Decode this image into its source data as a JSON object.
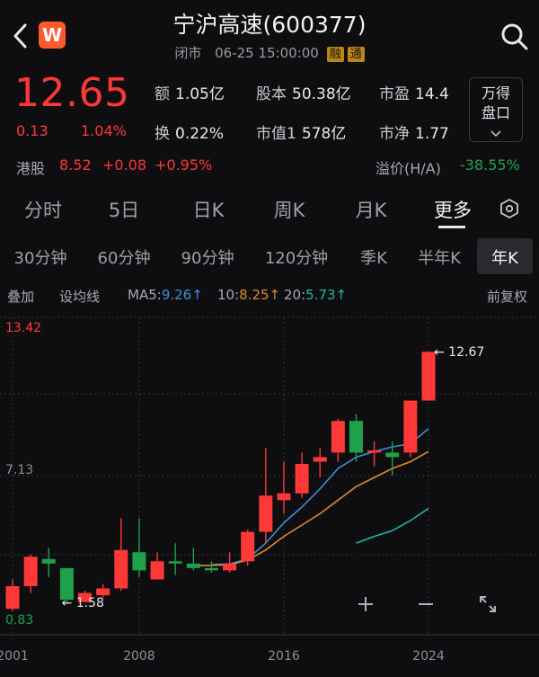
{
  "header": {
    "title": "宁沪高速(600377)",
    "market": "闭市",
    "datetime": "06-25 15:00:00",
    "tags": [
      "融",
      "通"
    ]
  },
  "quote": {
    "price": "12.65",
    "change": "0.13",
    "change_pct": "1.04%",
    "stats": {
      "amount_label": "额",
      "amount": "1.05亿",
      "share_label": "股本",
      "share": "50.38亿",
      "pe_label": "市盈",
      "pe": "14.4",
      "turnover_label": "换",
      "turnover": "0.22%",
      "mcap_label": "市值1",
      "mcap": "578亿",
      "pb_label": "市净",
      "pb": "1.77"
    },
    "wande": [
      "万得",
      "盘口"
    ]
  },
  "hk": {
    "label": "港股",
    "price": "8.52",
    "change": "+0.08",
    "change_pct": "+0.95%",
    "premium_label": "溢价(H/A)",
    "premium": "-38.55%"
  },
  "period_tabs": [
    "分时",
    "5日",
    "日K",
    "周K",
    "月K",
    "更多"
  ],
  "interval_tabs": [
    "30分钟",
    "60分钟",
    "90分钟",
    "120分钟",
    "季K",
    "半年K",
    "年K"
  ],
  "ma": {
    "overlay": "叠加",
    "setting": "设均线",
    "ma5_label": "MA5:",
    "ma5": "9.26↑",
    "ma10_label": "10:",
    "ma10": "8.25↑",
    "ma20_label": "20:",
    "ma20": "5.73↑",
    "adjust": "前复权"
  },
  "colors": {
    "up": "#ff3838",
    "down": "#1fa14b",
    "ma5": "#3b8fd8",
    "ma10": "#e08a2a",
    "ma20": "#1fb7a8"
  },
  "chart_data": {
    "type": "candlestick",
    "x_ticks": [
      "2001",
      "2008",
      "2016",
      "2024"
    ],
    "y_labels": {
      "top": "13.42",
      "mid": "7.13",
      "bottom": "0.83"
    },
    "ylim": [
      0.83,
      13.42
    ],
    "annotations": {
      "max": "12.67",
      "min": "1.58"
    },
    "candles": [
      {
        "year": 2001,
        "open": 1.3,
        "high": 2.6,
        "low": 1.2,
        "close": 2.3
      },
      {
        "year": 2002,
        "open": 2.3,
        "high": 3.7,
        "low": 2.0,
        "close": 3.6
      },
      {
        "year": 2003,
        "open": 3.5,
        "high": 4.0,
        "low": 2.7,
        "close": 3.3
      },
      {
        "year": 2004,
        "open": 3.1,
        "high": 3.1,
        "low": 1.5,
        "close": 1.7
      },
      {
        "year": 2005,
        "open": 1.6,
        "high": 2.1,
        "low": 1.58,
        "close": 2.0
      },
      {
        "year": 2006,
        "open": 1.9,
        "high": 2.4,
        "low": 1.8,
        "close": 2.2
      },
      {
        "year": 2007,
        "open": 2.2,
        "high": 5.3,
        "low": 2.1,
        "close": 3.9
      },
      {
        "year": 2008,
        "open": 3.8,
        "high": 5.3,
        "low": 2.7,
        "close": 3.0
      },
      {
        "year": 2009,
        "open": 2.6,
        "high": 3.8,
        "low": 2.6,
        "close": 3.4
      },
      {
        "year": 2010,
        "open": 3.4,
        "high": 4.2,
        "low": 2.8,
        "close": 3.3
      },
      {
        "year": 2011,
        "open": 3.3,
        "high": 4.0,
        "low": 3.0,
        "close": 3.1
      },
      {
        "year": 2012,
        "open": 3.1,
        "high": 3.4,
        "low": 2.9,
        "close": 3.0
      },
      {
        "year": 2013,
        "open": 3.0,
        "high": 3.8,
        "low": 2.9,
        "close": 3.3
      },
      {
        "year": 2014,
        "open": 3.4,
        "high": 4.8,
        "low": 3.2,
        "close": 4.7
      },
      {
        "year": 2015,
        "open": 4.7,
        "high": 8.4,
        "low": 4.2,
        "close": 6.3
      },
      {
        "year": 2016,
        "open": 6.1,
        "high": 7.8,
        "low": 5.5,
        "close": 6.4
      },
      {
        "year": 2017,
        "open": 6.4,
        "high": 8.2,
        "low": 6.2,
        "close": 7.7
      },
      {
        "year": 2018,
        "open": 7.8,
        "high": 8.4,
        "low": 7.1,
        "close": 8.0
      },
      {
        "year": 2019,
        "open": 8.2,
        "high": 9.7,
        "low": 7.8,
        "close": 9.6
      },
      {
        "year": 2020,
        "open": 9.6,
        "high": 9.9,
        "low": 7.8,
        "close": 8.2
      },
      {
        "year": 2021,
        "open": 8.2,
        "high": 8.7,
        "low": 7.6,
        "close": 8.3
      },
      {
        "year": 2022,
        "open": 8.2,
        "high": 8.7,
        "low": 7.2,
        "close": 8.0
      },
      {
        "year": 2023,
        "open": 8.2,
        "high": 10.5,
        "low": 8.0,
        "close": 10.5
      },
      {
        "year": 2024,
        "open": 10.5,
        "high": 12.67,
        "low": 10.5,
        "close": 12.65
      }
    ],
    "ma5": [
      [
        2012,
        3.25
      ],
      [
        2013,
        3.28
      ],
      [
        2014,
        3.5
      ],
      [
        2015,
        4.2
      ],
      [
        2016,
        5.1
      ],
      [
        2017,
        5.8
      ],
      [
        2018,
        6.6
      ],
      [
        2019,
        7.5
      ],
      [
        2020,
        8.0
      ],
      [
        2021,
        8.25
      ],
      [
        2022,
        8.45
      ],
      [
        2023,
        8.6
      ],
      [
        2024,
        9.26
      ]
    ],
    "ma10": [
      [
        2011,
        3.2
      ],
      [
        2012,
        3.22
      ],
      [
        2013,
        3.25
      ],
      [
        2014,
        3.45
      ],
      [
        2015,
        3.9
      ],
      [
        2016,
        4.5
      ],
      [
        2017,
        5.0
      ],
      [
        2018,
        5.5
      ],
      [
        2019,
        6.1
      ],
      [
        2020,
        6.7
      ],
      [
        2021,
        7.1
      ],
      [
        2022,
        7.5
      ],
      [
        2023,
        7.8
      ],
      [
        2024,
        8.25
      ]
    ],
    "ma20": [
      [
        2020,
        4.2
      ],
      [
        2021,
        4.5
      ],
      [
        2022,
        4.75
      ],
      [
        2023,
        5.2
      ],
      [
        2024,
        5.73
      ]
    ]
  }
}
